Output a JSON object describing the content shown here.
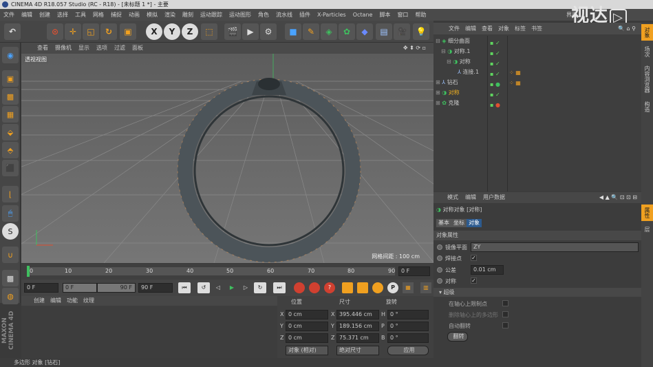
{
  "title": "CINEMA 4D R18.057 Studio (RC - R18) - [未标题 1 *] - 主要",
  "menu": [
    "文件",
    "编辑",
    "创建",
    "选择",
    "工具",
    "网格",
    "捕捉",
    "动画",
    "模拟",
    "渲染",
    "雕刻",
    "运动跟踪",
    "运动图形",
    "角色",
    "流水线",
    "插件",
    "X-Particles",
    "Octane",
    "脚本",
    "窗口",
    "帮助"
  ],
  "layout_label": "界面",
  "brand": "视达",
  "toolbar_icons": {
    "x": "X",
    "y": "Y",
    "z": "Z"
  },
  "viewport": {
    "menu": [
      "查看",
      "摄像机",
      "显示",
      "选项",
      "过滤",
      "面板"
    ],
    "label": "透视视图",
    "grid_info": "网格间距 : 100 cm"
  },
  "timeline": {
    "ticks": [
      "0",
      "10",
      "20",
      "30",
      "40",
      "50",
      "60",
      "70",
      "80",
      "90"
    ],
    "end_field": "0 F"
  },
  "transport": {
    "start": "0 F",
    "current": "0 F",
    "end_a": "90 F",
    "end_b": "90 F"
  },
  "materials": {
    "menu": [
      "创建",
      "编辑",
      "功能",
      "纹理"
    ]
  },
  "coords": {
    "headers": [
      "位置",
      "尺寸",
      "旋转"
    ],
    "rows": [
      {
        "axis": "X",
        "pos": "0 cm",
        "size": "395.446 cm",
        "rl": "H",
        "rot": "0 °"
      },
      {
        "axis": "Y",
        "pos": "0 cm",
        "size": "189.156 cm",
        "rl": "P",
        "rot": "0 °"
      },
      {
        "axis": "Z",
        "pos": "0 cm",
        "size": "75.371 cm",
        "rl": "B",
        "rot": "0 °"
      }
    ],
    "mode_a": "对象 (相对)",
    "mode_b": "绝对尺寸",
    "apply": "应用"
  },
  "status": "多边形 对象 [钻石]",
  "objects": {
    "menu": [
      "文件",
      "编辑",
      "查看",
      "对象",
      "标签",
      "书签"
    ],
    "items": [
      {
        "name": "细分曲面",
        "indent": 0,
        "color": "#cfe3b0"
      },
      {
        "name": "对称.1",
        "indent": 1,
        "color": "#cfe3b0"
      },
      {
        "name": "对称",
        "indent": 2,
        "color": "#cfe3b0"
      },
      {
        "name": "连接.1",
        "indent": 3,
        "color": "#9ec4ff"
      },
      {
        "name": "钻石",
        "indent": 0,
        "color": "#cfe3b0"
      },
      {
        "name": "对称",
        "indent": 0,
        "color": "#f0b020"
      },
      {
        "name": "克隆",
        "indent": 0,
        "color": "#cfe3b0"
      }
    ]
  },
  "attributes": {
    "menu": [
      "模式",
      "编辑",
      "用户数据"
    ],
    "header": "对称对象 [对称]",
    "tabs": [
      "基本",
      "坐标",
      "对象"
    ],
    "section": "对象属性",
    "mirror_label": "镜像平面",
    "mirror_value": "ZY",
    "weld_label": "焊接点",
    "tol_label": "公差",
    "tol_value": "0.01 cm",
    "sym_label": "对称",
    "adv_label": "▾ 超级",
    "opt1": "在轴心上限制点",
    "opt2": "删除轴心上的多边形",
    "opt3": "自动翻转",
    "flip": "翻转"
  },
  "right_tabs": [
    "对象",
    "场次",
    "内容浏览器",
    "构造",
    "属性",
    "层"
  ],
  "colors": {
    "accent": "#2d5b8f",
    "highlight": "#f0b020"
  }
}
